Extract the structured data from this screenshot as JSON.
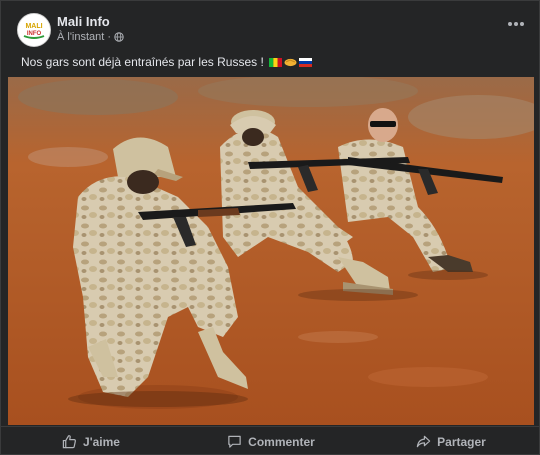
{
  "post": {
    "page_name": "Mali Info",
    "timestamp": "À l'instant",
    "privacy_icon": "globe-icon",
    "text": "Nos gars sont déjà entraînés par les Russes !",
    "emojis": [
      "flag-mali",
      "handshake",
      "flag-russia"
    ],
    "avatar_text_top": "MALI",
    "avatar_text_bottom": "INFO",
    "more_icon": "more-horizontal-icon"
  },
  "actions": {
    "like_label": "J'aime",
    "comment_label": "Commenter",
    "share_label": "Partager"
  },
  "colors": {
    "background": "#242526",
    "text_primary": "#e4e6eb",
    "text_secondary": "#b0b3b8",
    "ground": "#b05a2a"
  }
}
